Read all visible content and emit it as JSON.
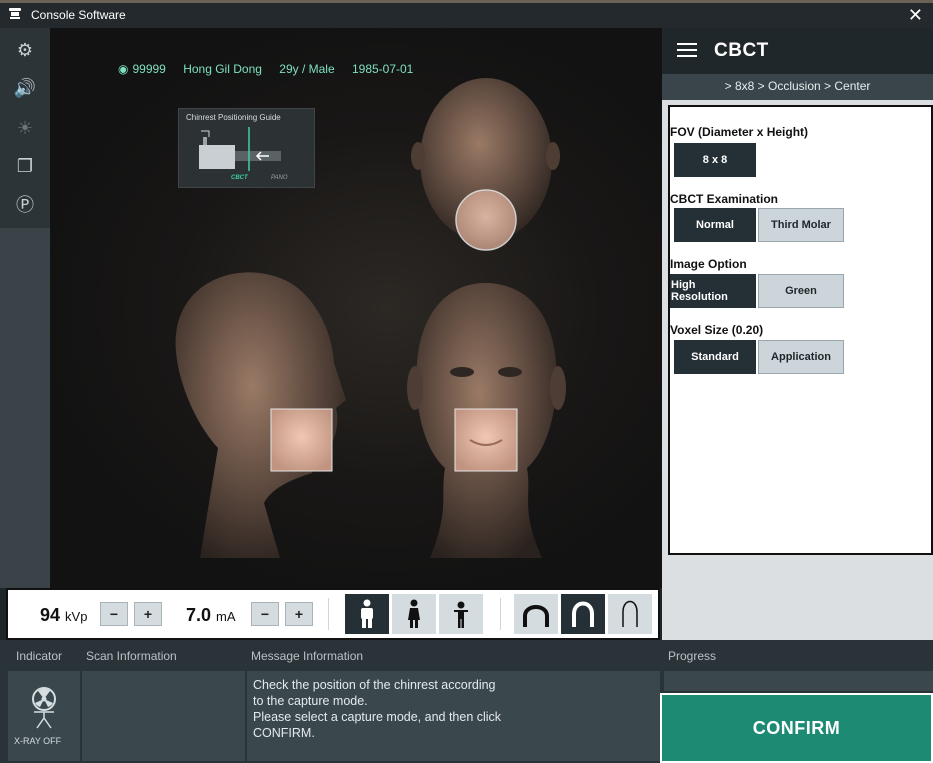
{
  "window": {
    "title": "Console Software",
    "app_icon": "app-icon",
    "close_glyph": "✕"
  },
  "left_toolbar": {
    "items": [
      {
        "icon": "gear-icon",
        "glyph": "⚙"
      },
      {
        "icon": "speaker-icon",
        "glyph": "🔊"
      },
      {
        "icon": "laser-icon",
        "glyph": "☀"
      },
      {
        "icon": "layers-icon",
        "glyph": "❐"
      },
      {
        "icon": "target-p-icon",
        "glyph": "Ⓟ"
      }
    ]
  },
  "patient": {
    "id": "99999",
    "name": "Hong Gil Dong",
    "age_sex": "29y / Male",
    "dob": "1985-07-01"
  },
  "chinrest_guide": {
    "title": "Chinrest Positioning Guide",
    "cbct_label": "CBCT",
    "pano_label": "PANO"
  },
  "right_panel": {
    "title": "CBCT",
    "breadcrumb": "> 8x8 > Occlusion > Center",
    "sections": {
      "fov": {
        "label": "FOV (Diameter x Height)",
        "options": [
          "8 x 8"
        ]
      },
      "exam": {
        "label": "CBCT Examination",
        "options": [
          "Normal",
          "Third Molar"
        ]
      },
      "image": {
        "label": "Image Option",
        "options": [
          "High Resolution",
          "Green"
        ]
      },
      "voxel": {
        "label": "Voxel Size (0.20)",
        "options": [
          "Standard",
          "Application"
        ]
      }
    }
  },
  "exposure": {
    "kvp_value": "94",
    "kvp_unit": "kVp",
    "ma_value": "7.0",
    "ma_unit": "mA",
    "minus": "−",
    "plus": "+"
  },
  "info": {
    "indicator_header": "Indicator",
    "scan_header": "Scan Information",
    "message_header": "Message Information",
    "progress_header": "Progress",
    "xray_status": "X-RAY OFF",
    "message_lines": [
      "Check the position of the chinrest according",
      "to the capture mode.",
      "Please select a capture mode, and then click",
      "CONFIRM."
    ]
  },
  "confirm_label": "CONFIRM",
  "colors": {
    "accent": "#40d0a0",
    "confirm": "#1d8a74",
    "dark": "#253036"
  }
}
